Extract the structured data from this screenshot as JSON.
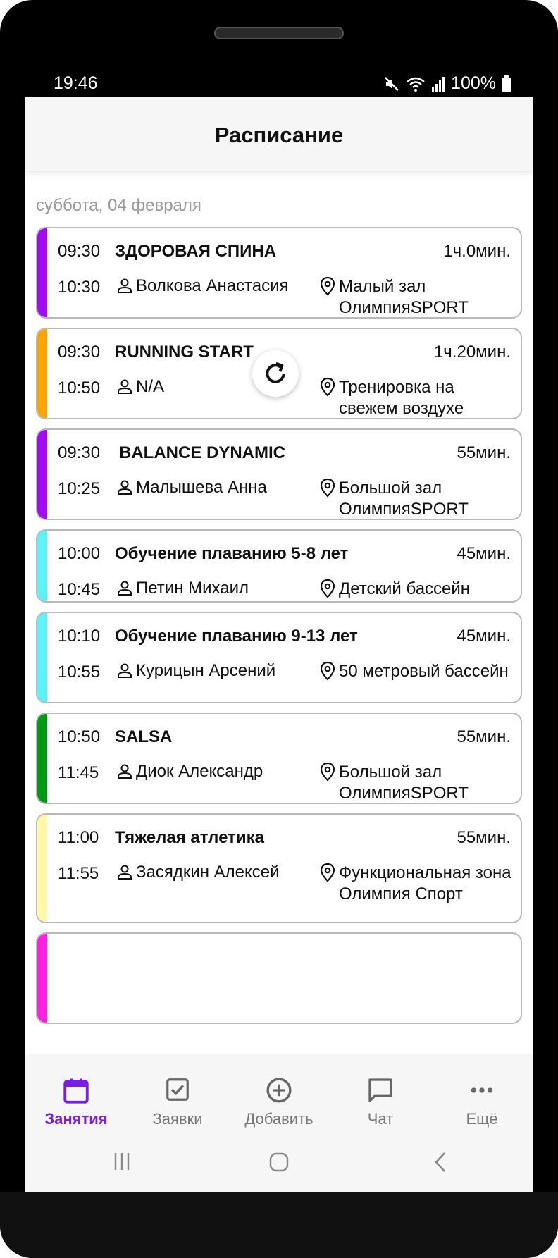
{
  "status": {
    "time": "19:46",
    "battery": "100%"
  },
  "appbar": {
    "title": "Расписание"
  },
  "schedule": {
    "date_header": "суббота, 04 февраля",
    "classes": [
      {
        "start": "09:30",
        "end": "10:30",
        "title": "ЗДОРОВАЯ СПИНА",
        "duration": "1ч.0мин.",
        "trainer": "Волкова Анастасия",
        "place": "Малый зал ОлимпияSPORT",
        "color": "#a10cf5"
      },
      {
        "start": "09:30",
        "end": "10:50",
        "title": "RUNNING START",
        "duration": "1ч.20мин.",
        "trainer": "N/A",
        "place": "Тренировка на свежем воздухе",
        "color": "#ffa500"
      },
      {
        "start": "09:30",
        "end": "10:25",
        "title": "BALANCE DYNAMIC",
        "duration": "55мин.",
        "trainer": "Малышева Анна",
        "place": "Большой зал ОлимпияSPORT",
        "color": "#a10cf5"
      },
      {
        "start": "10:00",
        "end": "10:45",
        "title": "Обучение плаванию 5-8 лет",
        "duration": "45мин.",
        "trainer": "Петин Михаил",
        "place": "Детский бассейн",
        "color": "#59f3f8"
      },
      {
        "start": "10:10",
        "end": "10:55",
        "title": "Обучение плаванию 9-13 лет",
        "duration": "45мин.",
        "trainer": "Курицын Арсений",
        "place": "50 метровый бассейн",
        "color": "#59f3f8"
      },
      {
        "start": "10:50",
        "end": "11:45",
        "title": "SALSA",
        "duration": "55мин.",
        "trainer": "Диок Александр",
        "place": "Большой зал ОлимпияSPORT",
        "color": "#009a10"
      },
      {
        "start": "11:00",
        "end": "11:55",
        "title": "Тяжелая атлетика",
        "duration": "55мин.",
        "trainer": "Засядкин Алексей",
        "place": "Функциональная зона Олимпия Спорт",
        "color": "#fff8a8"
      }
    ],
    "partial_card_color": "#ff20e0"
  },
  "bottom_nav": {
    "items": [
      {
        "label": "Занятия",
        "icon": "calendar-icon",
        "active": true
      },
      {
        "label": "Заявки",
        "icon": "checkbox-icon",
        "active": false
      },
      {
        "label": "Добавить",
        "icon": "add-circle-icon",
        "active": false
      },
      {
        "label": "Чат",
        "icon": "chat-icon",
        "active": false
      },
      {
        "label": "Ещё",
        "icon": "more-icon",
        "active": false
      }
    ]
  },
  "colors": {
    "accent": "#7a1fe0",
    "inactive": "#777777"
  }
}
